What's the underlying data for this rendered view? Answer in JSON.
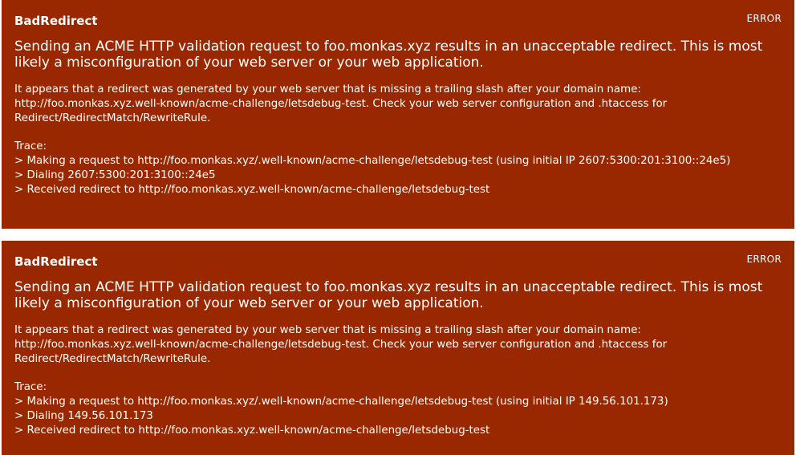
{
  "results": [
    {
      "title": "BadRedirect",
      "severity": "ERROR",
      "summary": "Sending an ACME HTTP validation request to foo.monkas.xyz results in an unacceptable redirect. This is most likely a misconfiguration of your web server or your web application.",
      "detail": "It appears that a redirect was generated by your web server that is missing a trailing slash after your domain name: http://foo.monkas.xyz.well-known/acme-challenge/letsdebug-test. Check your web server configuration and .htaccess for Redirect/RedirectMatch/RewriteRule.",
      "trace_label": "Trace:",
      "trace": [
        "> Making a request to http://foo.monkas.xyz/.well-known/acme-challenge/letsdebug-test (using initial IP 2607:5300:201:3100::24e5)",
        "> Dialing 2607:5300:201:3100::24e5",
        "> Received redirect to http://foo.monkas.xyz.well-known/acme-challenge/letsdebug-test"
      ]
    },
    {
      "title": "BadRedirect",
      "severity": "ERROR",
      "summary": "Sending an ACME HTTP validation request to foo.monkas.xyz results in an unacceptable redirect. This is most likely a misconfiguration of your web server or your web application.",
      "detail": "It appears that a redirect was generated by your web server that is missing a trailing slash after your domain name: http://foo.monkas.xyz.well-known/acme-challenge/letsdebug-test. Check your web server configuration and .htaccess for Redirect/RedirectMatch/RewriteRule.",
      "trace_label": "Trace:",
      "trace": [
        "> Making a request to http://foo.monkas.xyz/.well-known/acme-challenge/letsdebug-test (using initial IP 149.56.101.173)",
        "> Dialing 149.56.101.173",
        "> Received redirect to http://foo.monkas.xyz.well-known/acme-challenge/letsdebug-test"
      ]
    }
  ],
  "colors": {
    "card_background": "#992800",
    "text": "#ffffff",
    "page_background": "#ffffff"
  }
}
